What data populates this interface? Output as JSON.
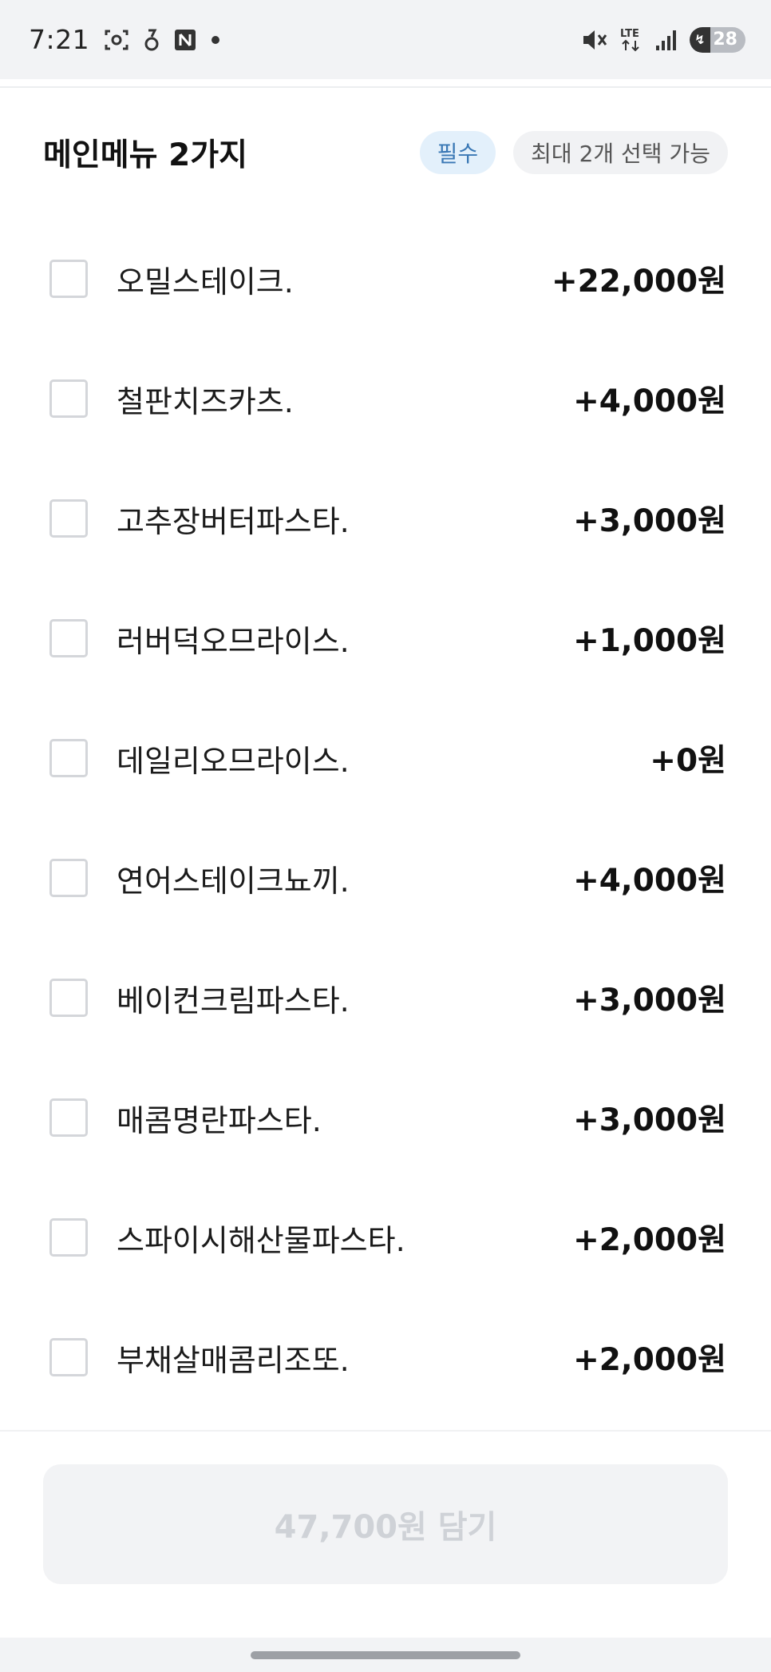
{
  "status_bar": {
    "time": "7:21",
    "left_icons": [
      "screenshot-icon",
      "notification-icon",
      "naver-icon",
      "dot-icon"
    ],
    "network": "LTE",
    "battery": "28"
  },
  "section": {
    "title": "메인메뉴 2가지",
    "required_badge": "필수",
    "max_badge": "최대 2개 선택 가능"
  },
  "options": [
    {
      "name": "오밀스테이크.",
      "price": "+22,000원"
    },
    {
      "name": "철판치즈카츠.",
      "price": "+4,000원"
    },
    {
      "name": "고추장버터파스타.",
      "price": "+3,000원"
    },
    {
      "name": "러버덕오므라이스.",
      "price": "+1,000원"
    },
    {
      "name": "데일리오므라이스.",
      "price": "+0원"
    },
    {
      "name": "연어스테이크뇨끼.",
      "price": "+4,000원"
    },
    {
      "name": "베이컨크림파스타.",
      "price": "+3,000원"
    },
    {
      "name": "매콤명란파스타.",
      "price": "+3,000원"
    },
    {
      "name": "스파이시해산물파스타.",
      "price": "+2,000원"
    },
    {
      "name": "부채살매콤리조또.",
      "price": "+2,000원"
    }
  ],
  "cart_button": {
    "label": "47,700원 담기"
  },
  "colors": {
    "accent_badge_bg": "#e3f0fb",
    "accent_badge_text": "#3a78b5",
    "disabled_button_bg": "#f2f3f5",
    "disabled_button_text": "#cfd2d7"
  }
}
